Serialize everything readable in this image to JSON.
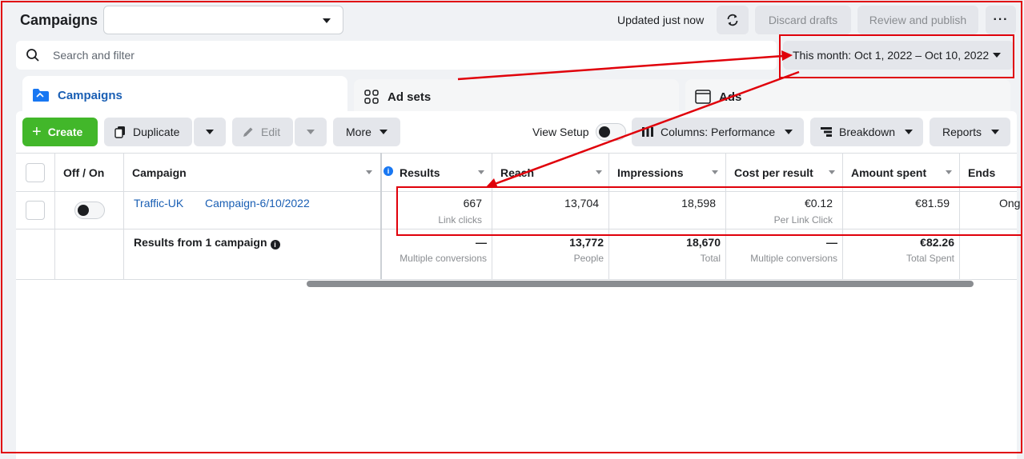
{
  "header": {
    "title": "Campaigns",
    "account_select_value": "",
    "updated_text": "Updated just now",
    "discard_label": "Discard drafts",
    "review_label": "Review and publish",
    "more_label": "···"
  },
  "search": {
    "placeholder": "Search and filter",
    "date_range": "This month: Oct 1, 2022 – Oct 10, 2022"
  },
  "tabs": [
    {
      "label": "Campaigns",
      "active": true,
      "icon": "folder-icon"
    },
    {
      "label": "Ad sets",
      "active": false,
      "icon": "grid-icon"
    },
    {
      "label": "Ads",
      "active": false,
      "icon": "ad-icon"
    }
  ],
  "toolbar": {
    "create_label": "Create",
    "duplicate_label": "Duplicate",
    "edit_label": "Edit",
    "more_label": "More",
    "view_setup_label": "View Setup",
    "columns_label": "Columns: Performance",
    "breakdown_label": "Breakdown",
    "reports_label": "Reports"
  },
  "table": {
    "headers": {
      "off_on": "Off / On",
      "campaign": "Campaign",
      "results": "Results",
      "reach": "Reach",
      "impressions": "Impressions",
      "cost_per_result": "Cost per result",
      "amount_spent": "Amount spent",
      "ends": "Ends"
    },
    "row": {
      "campaign_name": "Traffic-UK",
      "campaign_sub": "Campaign-6/10/2022",
      "results": "667",
      "results_sub": "Link clicks",
      "reach": "13,704",
      "impressions": "18,598",
      "cost_per_result": "€0.12",
      "cost_sub": "Per Link Click",
      "amount_spent": "€81.59",
      "ends": "Ong"
    },
    "summary": {
      "label": "Results from 1 campaign",
      "results": "—",
      "results_sub": "Multiple conversions",
      "reach": "13,772",
      "reach_sub": "People",
      "impressions": "18,670",
      "impressions_sub": "Total",
      "cost_per_result": "—",
      "cost_sub": "Multiple conversions",
      "amount_spent": "€82.26",
      "amount_sub": "Total Spent"
    }
  },
  "colors": {
    "accent": "#1a5fb4",
    "create": "#42b72a",
    "annotation": "#e0000a"
  }
}
